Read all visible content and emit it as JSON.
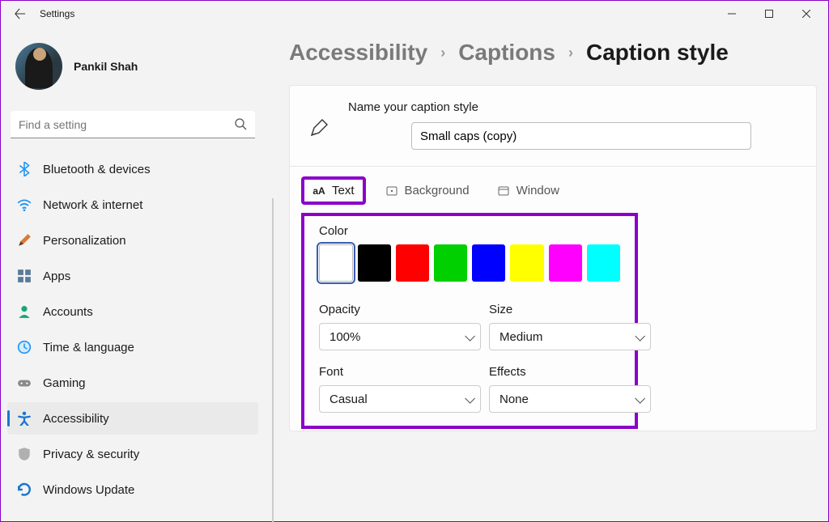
{
  "app_title": "Settings",
  "user": {
    "name": "Pankil Shah"
  },
  "search": {
    "placeholder": "Find a setting"
  },
  "sidebar": {
    "items": [
      {
        "id": "bluetooth",
        "label": "Bluetooth & devices"
      },
      {
        "id": "network",
        "label": "Network & internet"
      },
      {
        "id": "personalization",
        "label": "Personalization"
      },
      {
        "id": "apps",
        "label": "Apps"
      },
      {
        "id": "accounts",
        "label": "Accounts"
      },
      {
        "id": "time",
        "label": "Time & language"
      },
      {
        "id": "gaming",
        "label": "Gaming"
      },
      {
        "id": "accessibility",
        "label": "Accessibility"
      },
      {
        "id": "privacy",
        "label": "Privacy & security"
      },
      {
        "id": "update",
        "label": "Windows Update"
      }
    ],
    "active": "accessibility"
  },
  "breadcrumb": {
    "level1": "Accessibility",
    "level2": "Captions",
    "level3": "Caption style"
  },
  "caption_style": {
    "name_label": "Name your caption style",
    "name_value": "Small caps (copy)",
    "tabs": [
      {
        "id": "text",
        "label": "Text"
      },
      {
        "id": "background",
        "label": "Background"
      },
      {
        "id": "window",
        "label": "Window"
      }
    ],
    "active_tab": "text",
    "text_panel": {
      "color_label": "Color",
      "colors": [
        "#ffffff",
        "#000000",
        "#ff0000",
        "#00d000",
        "#0000ff",
        "#ffff00",
        "#ff00ff",
        "#00ffff"
      ],
      "selected_color_index": 0,
      "opacity": {
        "label": "Opacity",
        "value": "100%"
      },
      "size": {
        "label": "Size",
        "value": "Medium"
      },
      "font": {
        "label": "Font",
        "value": "Casual"
      },
      "effects": {
        "label": "Effects",
        "value": "None"
      }
    }
  },
  "highlight_color": "#8b00c9"
}
